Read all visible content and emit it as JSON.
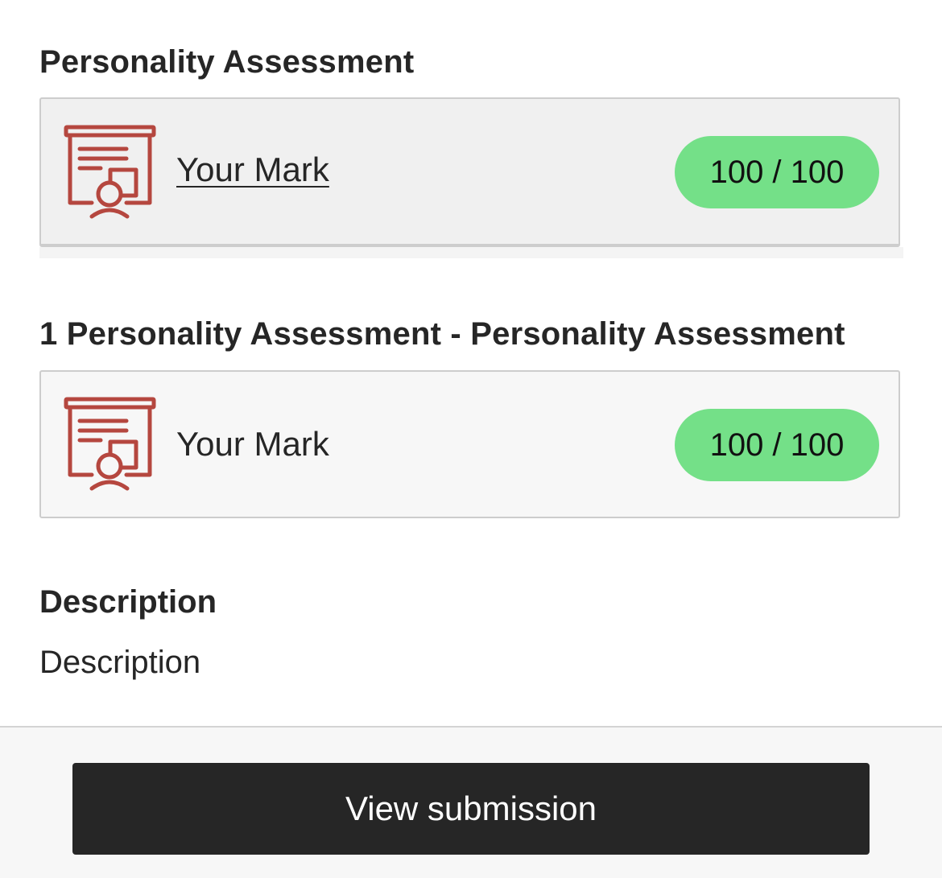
{
  "sections": [
    {
      "title": "Personality Assessment",
      "mark_label": "Your Mark",
      "mark_is_link": true,
      "score": "100 / 100"
    },
    {
      "title": "1 Personality Assessment - Personality Assessment",
      "mark_label": "Your Mark",
      "mark_is_link": false,
      "score": "100 / 100"
    }
  ],
  "description": {
    "heading": "Description",
    "text": "Description"
  },
  "footer": {
    "view_submission_label": "View submission"
  },
  "icons": {
    "assessment": "presentation-board-icon"
  },
  "colors": {
    "icon": "#b5473f",
    "score_badge": "#74e088",
    "button_bg": "#262626",
    "text": "#262626"
  }
}
